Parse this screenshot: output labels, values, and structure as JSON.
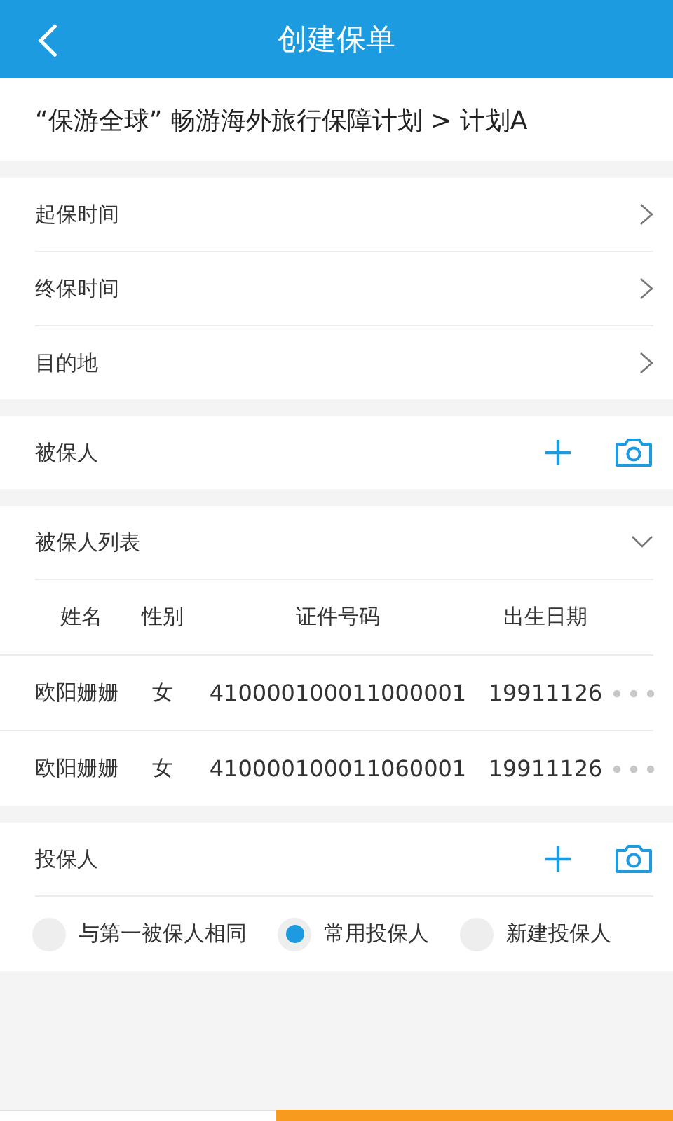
{
  "header": {
    "title": "创建保单"
  },
  "plan_title": "“保游全球” 畅游海外旅行保障计划 > 计划A",
  "date_fields": [
    {
      "label": "起保时间"
    },
    {
      "label": "终保时间"
    },
    {
      "label": "目的地"
    }
  ],
  "insured": {
    "label": "被保人"
  },
  "insured_list": {
    "title": "被保人列表",
    "expanded": true,
    "columns": [
      "姓名",
      "性别",
      "证件号码",
      "出生日期"
    ],
    "rows": [
      {
        "name": "欧阳姗姗",
        "sex": "女",
        "id": "410000100011000001",
        "birth": "19911126"
      },
      {
        "name": "欧阳姗姗",
        "sex": "女",
        "id": "410000100011060001",
        "birth": "19911126"
      }
    ]
  },
  "policyholder": {
    "label": "投保人",
    "options": [
      {
        "label": "与第一被保人相同",
        "selected": false
      },
      {
        "label": "常用投保人",
        "selected": true
      },
      {
        "label": "新建投保人",
        "selected": false
      }
    ]
  }
}
